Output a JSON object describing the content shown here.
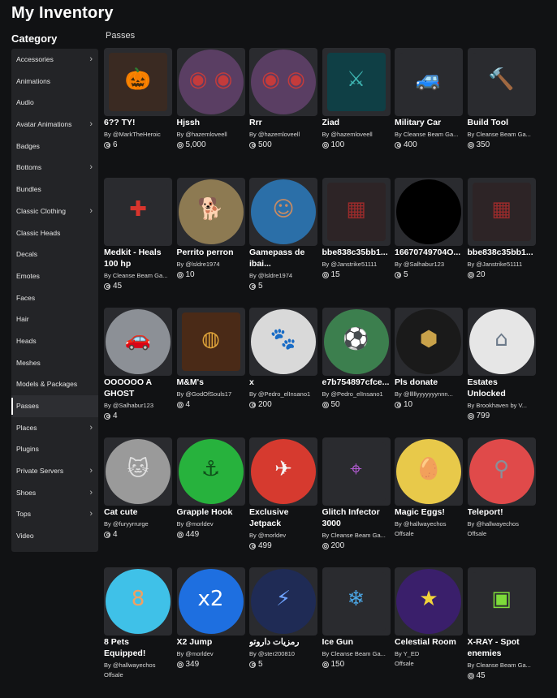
{
  "header": {
    "title": "My Inventory"
  },
  "sidebar": {
    "title": "Category",
    "active": "Passes",
    "items": [
      {
        "label": "Accessories",
        "chevron": true
      },
      {
        "label": "Animations",
        "chevron": false
      },
      {
        "label": "Audio",
        "chevron": false
      },
      {
        "label": "Avatar Animations",
        "chevron": true
      },
      {
        "label": "Badges",
        "chevron": false
      },
      {
        "label": "Bottoms",
        "chevron": true
      },
      {
        "label": "Bundles",
        "chevron": false
      },
      {
        "label": "Classic Clothing",
        "chevron": true
      },
      {
        "label": "Classic Heads",
        "chevron": false
      },
      {
        "label": "Decals",
        "chevron": false
      },
      {
        "label": "Emotes",
        "chevron": false
      },
      {
        "label": "Faces",
        "chevron": false
      },
      {
        "label": "Hair",
        "chevron": false
      },
      {
        "label": "Heads",
        "chevron": false
      },
      {
        "label": "Meshes",
        "chevron": false
      },
      {
        "label": "Models & Packages",
        "chevron": false
      },
      {
        "label": "Passes",
        "chevron": false
      },
      {
        "label": "Places",
        "chevron": true
      },
      {
        "label": "Plugins",
        "chevron": false
      },
      {
        "label": "Private Servers",
        "chevron": true
      },
      {
        "label": "Shoes",
        "chevron": true
      },
      {
        "label": "Tops",
        "chevron": true
      },
      {
        "label": "Video",
        "chevron": false
      }
    ]
  },
  "section": {
    "title": "Passes"
  },
  "items": [
    {
      "name": "6?? TY!",
      "creator": "By @MarkTheHeroic",
      "price": "6",
      "icon": "pumpkin-icon",
      "shape": "sq",
      "bg": "#3a2a22",
      "accent": "#e8761e"
    },
    {
      "name": "Hjssh",
      "creator": "By @hazemloveell",
      "price": "5,000",
      "icon": "eyes-icon",
      "shape": "circle",
      "bg": "#5a3e63",
      "accent": "#c43b3b"
    },
    {
      "name": "Rrr",
      "creator": "By @hazemloveell",
      "price": "500",
      "icon": "eyes-icon",
      "shape": "circle",
      "bg": "#5a3e63",
      "accent": "#c43b3b"
    },
    {
      "name": "Ziad",
      "creator": "By @hazemloveell",
      "price": "100",
      "icon": "character-icon",
      "shape": "sq",
      "bg": "#0f3f45",
      "accent": "#3fb6b3"
    },
    {
      "name": "Military Car",
      "creator": "By Cleanse Beam Ga...",
      "price": "400",
      "icon": "car-icon",
      "shape": "sq",
      "bg": "#2a2b2f",
      "accent": "#4fcf3a"
    },
    {
      "name": "Build Tool",
      "creator": "By Cleanse Beam Ga...",
      "price": "350",
      "icon": "build-tool-icon",
      "shape": "sq",
      "bg": "#2a2b2f",
      "accent": "#f2c230"
    },
    {
      "name": "Medkit - Heals 100 hp",
      "creator": "By Cleanse Beam Ga...",
      "price": "45",
      "icon": "medkit-icon",
      "shape": "sq",
      "bg": "#2a2b2f",
      "accent": "#d9352d"
    },
    {
      "name": "Perrito perron",
      "creator": "By @lsldre1974",
      "price": "10",
      "icon": "dog-icon",
      "shape": "circle",
      "bg": "#8d7a52",
      "accent": "#d9c7a0"
    },
    {
      "name": "Gamepass de ibai...",
      "creator": "By @lsldre1974",
      "price": "5",
      "icon": "person-icon",
      "shape": "circle",
      "bg": "#2b6fa8",
      "accent": "#c98b62"
    },
    {
      "name": "bbe838c35bb1...",
      "creator": "By @Janstrike51111",
      "price": "15",
      "icon": "glitch-icon",
      "shape": "sq",
      "bg": "#2d2426",
      "accent": "#9a2b2b"
    },
    {
      "name": "16670749704O...",
      "creator": "By @Salhabur123",
      "price": "5",
      "icon": "black-circle-icon",
      "shape": "circle",
      "bg": "#000000",
      "accent": "#000000"
    },
    {
      "name": "bbe838c35bb1...",
      "creator": "By @Janstrike51111",
      "price": "20",
      "icon": "glitch-icon",
      "shape": "sq",
      "bg": "#2d2426",
      "accent": "#9a2b2b"
    },
    {
      "name": "OOOOOO A GHOST",
      "creator": "By @Salhabur123",
      "price": "4",
      "icon": "street-icon",
      "shape": "circle",
      "bg": "#8c9096",
      "accent": "#c7cacf"
    },
    {
      "name": "M&M's",
      "creator": "By @GodOfSouls17",
      "price": "4",
      "icon": "candy-icon",
      "shape": "sq",
      "bg": "#4a2a17",
      "accent": "#e0a43a"
    },
    {
      "name": "x",
      "creator": "By @Pedro_elInsano1",
      "price": "200",
      "icon": "dalmatian-icon",
      "shape": "circle",
      "bg": "#d9d9d9",
      "accent": "#222222"
    },
    {
      "name": "e7b754897cfce...",
      "creator": "By @Pedro_elInsano1",
      "price": "50",
      "icon": "soccer-icon",
      "shape": "circle",
      "bg": "#3c7f4e",
      "accent": "#c0392b"
    },
    {
      "name": "Pls donate",
      "creator": "By @lllllyyyyyyynnn...",
      "price": "10",
      "icon": "robux-coin-icon",
      "shape": "circle",
      "bg": "#1a1a1a",
      "accent": "#c9a24a"
    },
    {
      "name": "Estates Unlocked",
      "creator": "By Brookhaven by V...",
      "price": "799",
      "icon": "house-badge-icon",
      "shape": "circle",
      "bg": "#e6e6e6",
      "accent": "#6c7a8a"
    },
    {
      "name": "Cat cute",
      "creator": "By @furyyrrurge",
      "price": "4",
      "icon": "cat-icon",
      "shape": "circle",
      "bg": "#9a9a9a",
      "accent": "#e0e0e0"
    },
    {
      "name": "Grapple Hook",
      "creator": "By @morldev",
      "price": "449",
      "icon": "grapple-icon",
      "shape": "circle",
      "bg": "#27b23d",
      "accent": "#0f4f1a"
    },
    {
      "name": "Exclusive Jetpack",
      "creator": "By @morldev",
      "price": "499",
      "icon": "jetpack-icon",
      "shape": "circle",
      "bg": "#d63a2f",
      "accent": "#f5f5f5"
    },
    {
      "name": "Glitch Infector 3000",
      "creator": "By Cleanse Beam Ga...",
      "price": "200",
      "icon": "glitch-gun-icon",
      "shape": "sq",
      "bg": "#2a2b2f",
      "accent": "#b55cd6"
    },
    {
      "name": "Magic Eggs!",
      "creator": "By @hallwayechos",
      "offsale": "Offsale",
      "icon": "egg-icon",
      "shape": "circle",
      "bg": "#e8c94a",
      "accent": "#9b59b6"
    },
    {
      "name": "Teleport!",
      "creator": "By @hallwayechos",
      "offsale": "Offsale",
      "icon": "teleport-icon",
      "shape": "circle",
      "bg": "#e04a4a",
      "accent": "#8a8f99"
    },
    {
      "name": "8 Pets Equipped!",
      "creator": "By @hallwayechos",
      "offsale": "Offsale",
      "icon": "pet-icon",
      "shape": "circle",
      "bg": "#3fc1e8",
      "accent": "#f0a062"
    },
    {
      "name": "X2 Jump",
      "creator": "By @morldev",
      "price": "349",
      "icon": "x2-jump-icon",
      "shape": "circle",
      "bg": "#1e6fe0",
      "accent": "#ffffff"
    },
    {
      "name": "رمزيات داروتو",
      "creator": "By @ster200810",
      "price": "5",
      "icon": "anime-icon",
      "shape": "circle",
      "bg": "#1f2b55",
      "accent": "#6fa3ff"
    },
    {
      "name": "Ice Gun",
      "creator": "By Cleanse Beam Ga...",
      "price": "150",
      "icon": "ice-gun-icon",
      "shape": "sq",
      "bg": "#2a2b2f",
      "accent": "#4aa3e0"
    },
    {
      "name": "Celestial Room",
      "creator": "By Y_ED",
      "offsale": "Offsale",
      "icon": "star-icon",
      "shape": "circle",
      "bg": "#3a1f6b",
      "accent": "#f2d43a"
    },
    {
      "name": "X-RAY - Spot enemies",
      "creator": "By Cleanse Beam Ga...",
      "price": "45",
      "icon": "xray-icon",
      "shape": "sq",
      "bg": "#2a2b2f",
      "accent": "#7ddc3a"
    }
  ]
}
